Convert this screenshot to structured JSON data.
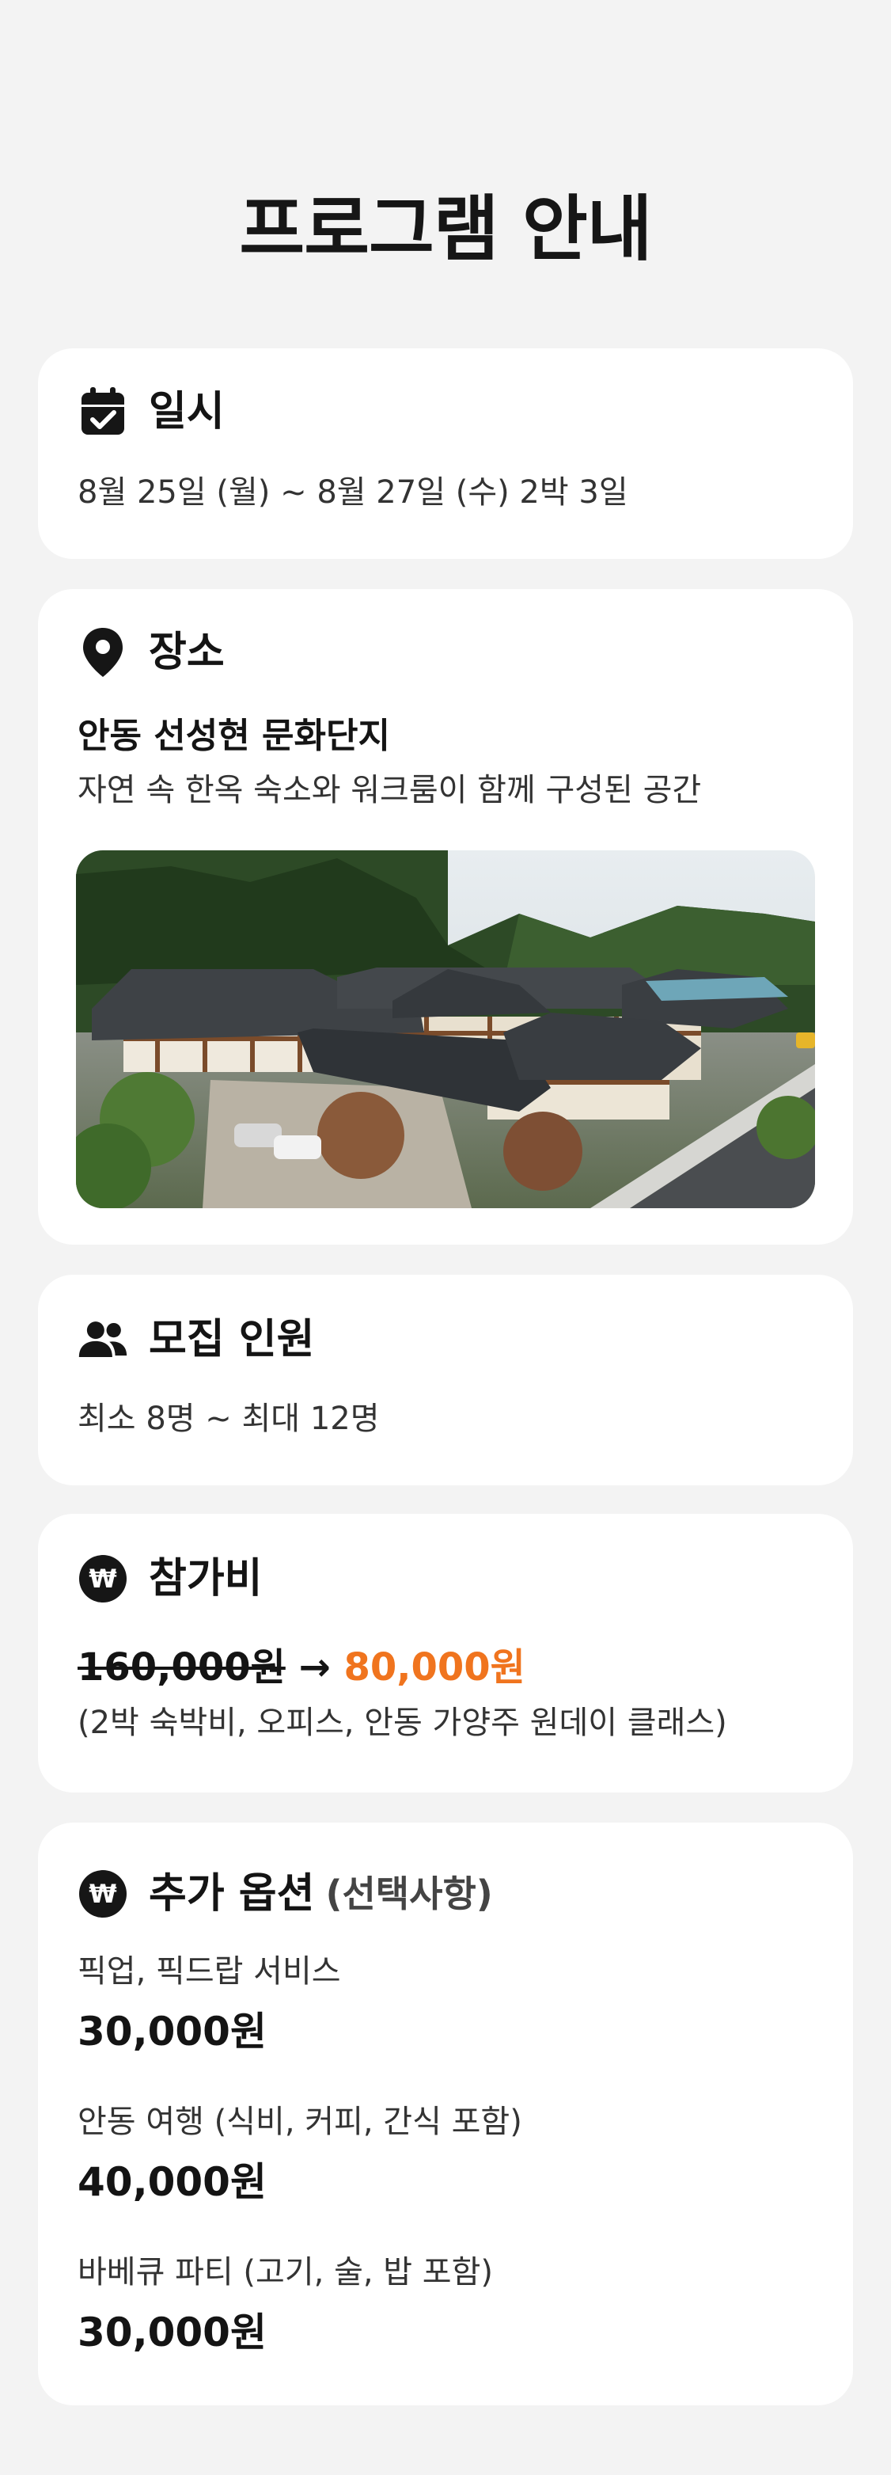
{
  "page": {
    "title": "프로그램 안내"
  },
  "schedule": {
    "icon": "calendar-check-icon",
    "title": "일시",
    "text": "8월 25일 (월) ~ 8월 27일 (수) 2박 3일"
  },
  "venue": {
    "icon": "location-pin-icon",
    "title": "장소",
    "name": "안동 선성현 문화단지",
    "description": "자연 속 한옥 숙소와 워크룸이 함께 구성된 공간",
    "photo": "hanok-village-photo"
  },
  "recruitment": {
    "icon": "people-icon",
    "title": "모집 인원",
    "text": "최소 8명 ~ 최대 12명"
  },
  "fee": {
    "icon": "won-coin-icon",
    "title": "참가비",
    "original_price": "160,000원",
    "arrow": "→",
    "sale_price": "80,000원",
    "includes": "(2박 숙박비, 오피스, 안동 가양주 원데이 클래스)",
    "accent_color": "#f0741e"
  },
  "options": {
    "icon": "won-coin-icon",
    "title": "추가 옵션",
    "subtitle": "(선택사항)",
    "items": [
      {
        "name": "픽업, 픽드랍 서비스",
        "price": "30,000원"
      },
      {
        "name": "안동 여행 (식비, 커피, 간식 포함)",
        "price": "40,000원"
      },
      {
        "name": "바베큐 파티 (고기, 술, 밥 포함)",
        "price": "30,000원"
      }
    ]
  }
}
